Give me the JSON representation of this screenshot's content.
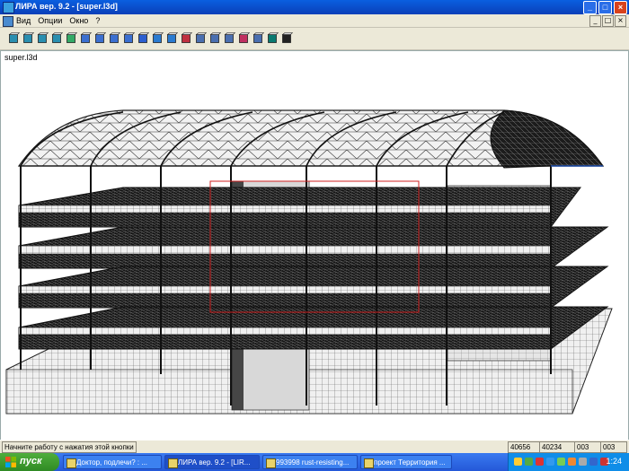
{
  "window": {
    "title": "ЛИРА  вер. 9.2 - [super.l3d]",
    "buttons": [
      "_",
      "□",
      "×"
    ]
  },
  "menu": {
    "items": [
      "Вид",
      "Опции",
      "Окно",
      "?"
    ],
    "mdi_buttons": [
      "_",
      "□",
      "×"
    ]
  },
  "toolbar": {
    "tools": [
      {
        "name": "cube-view-icon",
        "color": "#2a8fb0"
      },
      {
        "name": "cube-grid-icon",
        "color": "#2a8fb0"
      },
      {
        "name": "cube-blue-icon",
        "color": "#2a8fb0"
      },
      {
        "name": "rotate-view-icon",
        "color": "#2a8fb0"
      },
      {
        "name": "axes-icon",
        "color": "#3a6"
      },
      {
        "name": "shade-sphere-icon",
        "color": "#3b6fd0"
      },
      {
        "name": "blue-shape-icon",
        "color": "#3b6fd0"
      },
      {
        "name": "curve-icon",
        "color": "#3b6fd0"
      },
      {
        "name": "outline-shape-icon",
        "color": "#3b6fd0"
      },
      {
        "name": "sphere-icon",
        "color": "#2c5fd0"
      },
      {
        "name": "blue-box-icon",
        "color": "#2a7bd0"
      },
      {
        "name": "box-icon",
        "color": "#2a7bd0"
      },
      {
        "name": "colored-cube-icon",
        "color": "#c03040"
      },
      {
        "name": "net-icon",
        "color": "#4a6fb0"
      },
      {
        "name": "select-node-icon",
        "color": "#4a6fb0"
      },
      {
        "name": "mesh-icon",
        "color": "#4a6fb0"
      },
      {
        "name": "cube-pointer-icon",
        "color": "#c03060"
      },
      {
        "name": "cube-dots-icon",
        "color": "#4a6fb0"
      },
      {
        "name": "info-box-icon",
        "color": "#0a7a70"
      },
      {
        "name": "help-pointer-icon",
        "color": "#222"
      }
    ]
  },
  "view": {
    "doc_label": "super.l3d"
  },
  "status": {
    "message": "Начните работу с нажатия этой кнопки",
    "cells": [
      "40656",
      "40234",
      "003",
      "003"
    ]
  },
  "taskbar": {
    "start_label": "пуск",
    "tasks": [
      "Доктор, подлечи? : ...",
      "ЛИРА вер. 9.2 - [LIR...",
      "993998 rust-resisting...",
      "проект Территория ..."
    ],
    "active_task": 1,
    "clock": "1:24",
    "tray_colors": [
      "#ffcc33",
      "#55aa44",
      "#dd3333",
      "#3399ee",
      "#77cc55",
      "#ee8833",
      "#aaaaaa",
      "#3366cc",
      "#cc3333"
    ]
  }
}
